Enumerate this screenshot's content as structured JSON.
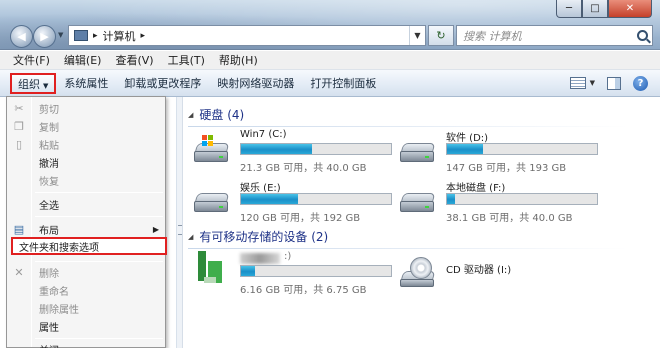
{
  "address": {
    "separator": "▸",
    "path": "计算机",
    "search_placeholder": "搜索 计算机"
  },
  "window_buttons": {
    "minimize": "─",
    "maximize": "□",
    "close": "✕"
  },
  "menubar": [
    "文件(F)",
    "编辑(E)",
    "查看(V)",
    "工具(T)",
    "帮助(H)"
  ],
  "commands": {
    "organize": "组织",
    "items": [
      "系统属性",
      "卸载或更改程序",
      "映射网络驱动器",
      "打开控制面板"
    ]
  },
  "dropdown": {
    "cut": "剪切",
    "copy": "复制",
    "paste": "粘贴",
    "undo": "撤消",
    "redo": "恢复",
    "select_all": "全选",
    "layout": "布局",
    "folder_options": "文件夹和搜索选项",
    "delete": "删除",
    "rename": "重命名",
    "remove_properties": "删除属性",
    "properties": "属性",
    "close": "关闭"
  },
  "groups": {
    "hdd": "硬盘 (4)",
    "removable": "有可移动存储的设备 (2)"
  },
  "drives": [
    {
      "name": "Win7 (C:)",
      "size": "21.3 GB 可用，共 40.0 GB",
      "used_fraction": 0.47,
      "system": true
    },
    {
      "name": "软件 (D:)",
      "size": "147 GB 可用，共 193 GB",
      "used_fraction": 0.24,
      "system": false
    },
    {
      "name": "娱乐 (E:)",
      "size": "120 GB 可用，共 192 GB",
      "used_fraction": 0.38,
      "system": false
    },
    {
      "name": "本地磁盘 (F:)",
      "size": "38.1 GB 可用，共 40.0 GB",
      "used_fraction": 0.05,
      "system": false
    }
  ],
  "removable": [
    {
      "name_tail": ":)",
      "size": "6.16 GB 可用，共 6.75 GB",
      "used_fraction": 0.09
    },
    {
      "name": "CD 驱动器 (I:)"
    }
  ],
  "colors": {
    "accent_red": "#e02020",
    "bar_fill": "#26a0d8",
    "group_header": "#1e3287"
  }
}
